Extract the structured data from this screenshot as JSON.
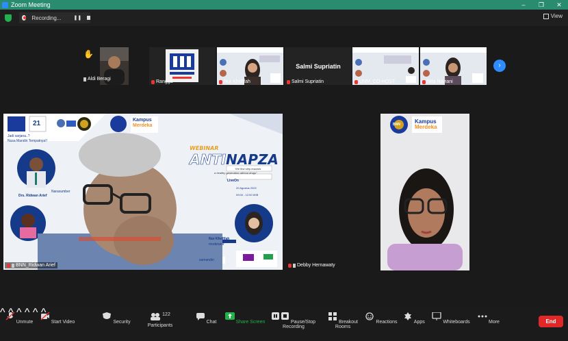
{
  "window": {
    "title": "Zoom Meeting",
    "controls": [
      "–",
      "❐",
      "✕"
    ]
  },
  "topbar": {
    "recording_label": "Recording...",
    "pause_glyph": "❚❚",
    "view_label": "View"
  },
  "thumbnails": [
    {
      "name": "Aldi Beragi",
      "hand_raised": true
    },
    {
      "name": "Rangga"
    },
    {
      "name": "Nur Khofifah"
    },
    {
      "name": "Salmi Supriatin",
      "display_name": "Salmi Supriatin"
    },
    {
      "name": "UNM_CO-HOST"
    },
    {
      "name": "Nita Noviani"
    }
  ],
  "next_glyph": "›",
  "main_video": {
    "label": "BNN_Ridwan Arief",
    "poster": {
      "line1": "Jadi sarjana..?",
      "line2": "Nusa Mandiri Tempatnya!!",
      "webinar": "WEBINAR",
      "title_a": "ANTI",
      "title_b": "NAPZA",
      "tagline1": "\"the first step towards",
      "tagline2": "a healthy generation without drugs\"",
      "live_on": "LiveOn",
      "date": "20 Agustus 2022",
      "time": "09:00 - 12:00 WIB",
      "narasumber": "Narasumber",
      "speaker_name": "Drs. Ridwan Arief",
      "moderator_name": "Nur Khofifah",
      "moderator_role": "moderator",
      "kampus": "Kampus",
      "merdeka": "Merdeka",
      "handle": "samandiri",
      "logo21": "21"
    }
  },
  "right_video": {
    "label": "Debby Hernawaty",
    "kampus": "Kampus",
    "merdeka": "Merdeka",
    "bnn": "BNN"
  },
  "toolbar": {
    "unmute": "Unmute",
    "start_video": "Start Video",
    "security": "Security",
    "participants": "Participants",
    "participants_count": "122",
    "chat": "Chat",
    "share": "Share Screen",
    "pause_record": "Pause/Stop Recording",
    "breakout": "Breakout Rooms",
    "reactions": "Reactions",
    "apps": "Apps",
    "whiteboards": "Whiteboards",
    "more": "More",
    "end": "End",
    "caret": "^"
  },
  "colors": {
    "accent": "#2d8cff",
    "titlebar": "#2a8c6f",
    "share": "#22b14c",
    "end": "#e02828"
  }
}
